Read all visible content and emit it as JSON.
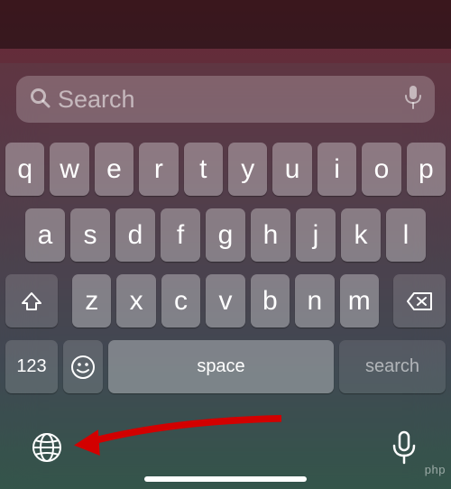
{
  "search": {
    "placeholder": "Search"
  },
  "keyboard": {
    "row1": [
      "q",
      "w",
      "e",
      "r",
      "t",
      "y",
      "u",
      "i",
      "o",
      "p"
    ],
    "row2": [
      "a",
      "s",
      "d",
      "f",
      "g",
      "h",
      "j",
      "k",
      "l"
    ],
    "row3": [
      "z",
      "x",
      "c",
      "v",
      "b",
      "n",
      "m"
    ],
    "numbers_label": "123",
    "space_label": "space",
    "action_label": "search"
  },
  "icons": {
    "search": "search-icon",
    "mic": "microphone-icon",
    "shift": "shift-icon",
    "delete": "delete-icon",
    "emoji": "emoji-icon",
    "globe": "globe-icon",
    "dictation": "dictation-icon"
  },
  "watermark": "php"
}
